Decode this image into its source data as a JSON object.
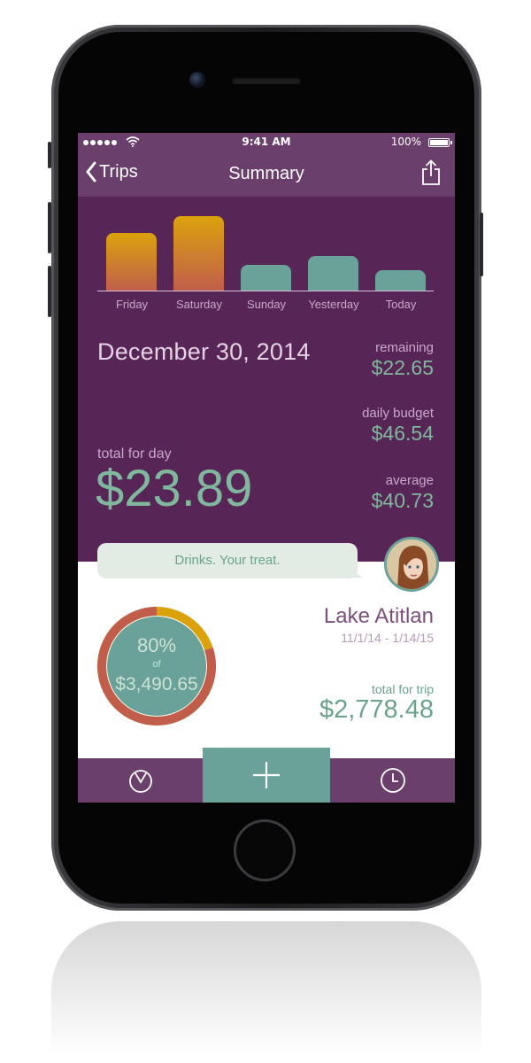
{
  "status_bar": {
    "time": "9:41 AM",
    "battery": "100%"
  },
  "nav": {
    "back_label": "Trips",
    "title": "Summary"
  },
  "chart_data": {
    "type": "bar",
    "categories": [
      "Friday",
      "Saturday",
      "Sunday",
      "Yesterday",
      "Today"
    ],
    "values": [
      45,
      58,
      20,
      27,
      16
    ],
    "colors": [
      "#dba20c",
      "#dba20c",
      "#6aa198",
      "#6aa198",
      "#6aa198"
    ]
  },
  "summary": {
    "date": "December 30, 2014",
    "remaining_label": "remaining",
    "remaining_value": "$22.65",
    "daily_budget_label": "daily budget",
    "daily_budget_value": "$46.54",
    "average_label": "average",
    "average_value": "$40.73",
    "total_label": "total for day",
    "total_value": "$23.89"
  },
  "message": {
    "text": "Drinks. Your treat."
  },
  "trip": {
    "percent_label": "80%",
    "percent_value": 0.8,
    "of_label": "of",
    "budget_total": "$3,490.65",
    "name": "Lake Atitlan",
    "dates": "11/1/14 - 1/14/15",
    "total_label": "total for trip",
    "total_value": "$2,778.48"
  },
  "colors": {
    "purple_dark": "#572656",
    "purple_bar": "#6b3f6b",
    "green_accent": "#6aa198",
    "gold": "#dba20c",
    "rust": "#c05e4b"
  },
  "icons": [
    "chevron-left-icon",
    "share-icon",
    "wifi-icon",
    "gauge-icon",
    "plus-icon",
    "clock-icon"
  ]
}
